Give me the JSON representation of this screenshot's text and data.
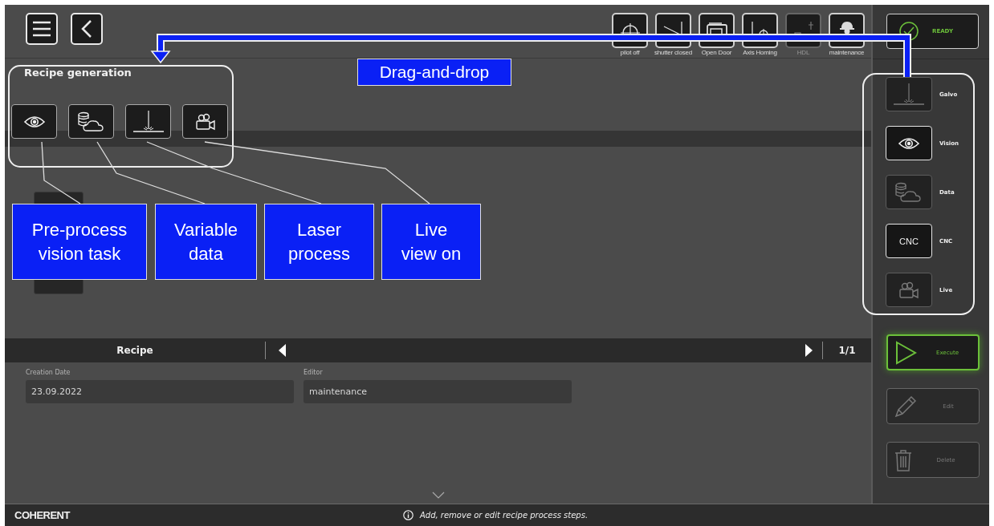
{
  "toolbar": {
    "status_items": [
      {
        "label": "pilot off",
        "kind": "pilot",
        "disabled": false
      },
      {
        "label": "shutter closed",
        "kind": "shutter",
        "disabled": false
      },
      {
        "label": "Open Door",
        "kind": "door",
        "disabled": false
      },
      {
        "label": "Axis Homing",
        "kind": "homing",
        "disabled": false
      },
      {
        "label": "HDL",
        "kind": "hdl",
        "disabled": true
      },
      {
        "label": "maintenance",
        "kind": "worker",
        "disabled": false
      }
    ]
  },
  "ready_button": {
    "label": "READY"
  },
  "recipe_generation": {
    "title": "Recipe generation",
    "steps": [
      {
        "kind": "vision"
      },
      {
        "kind": "data"
      },
      {
        "kind": "laser"
      },
      {
        "kind": "live"
      }
    ]
  },
  "process_tools": [
    {
      "label": "Galvo",
      "kind": "laser",
      "active": false
    },
    {
      "label": "Vision",
      "kind": "vision",
      "active": true
    },
    {
      "label": "Data",
      "kind": "data",
      "active": false
    },
    {
      "label": "CNC",
      "kind": "text",
      "icon_text": "CNC",
      "active": true
    },
    {
      "label": "Live",
      "kind": "live",
      "active": false
    }
  ],
  "recipe_bar": {
    "title": "Recipe",
    "page": "1/1"
  },
  "fields": [
    {
      "label": "Creation Date",
      "value": "23.09.2022"
    },
    {
      "label": "Editor",
      "value": "maintenance"
    }
  ],
  "actions": [
    {
      "label": "Execute",
      "kind": "execute",
      "disabled": false
    },
    {
      "label": "Edit",
      "kind": "edit",
      "disabled": true
    },
    {
      "label": "Delete",
      "kind": "delete",
      "disabled": true
    }
  ],
  "footer": {
    "brand": "COHERENT",
    "hint": "Add, remove or edit recipe process steps."
  },
  "annotations": {
    "drag_label": "Drag-and-drop",
    "callouts": [
      "Pre-process\nvision task",
      "Variable\ndata",
      "Laser\nprocess",
      "Live\nview on"
    ]
  }
}
